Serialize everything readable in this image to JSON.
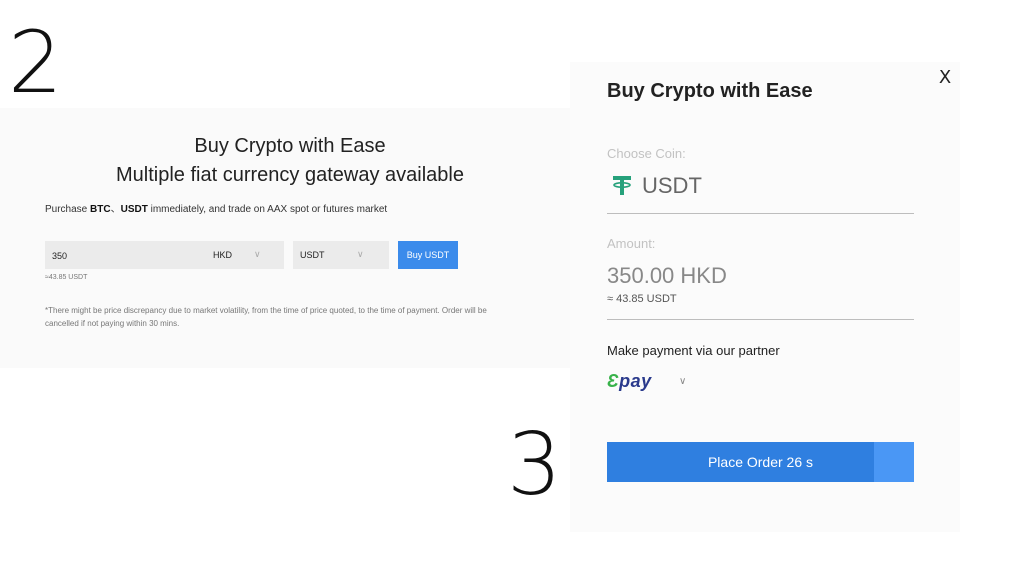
{
  "steps": {
    "left": "2",
    "right": "3"
  },
  "left_panel": {
    "title_line1": "Buy Crypto with Ease",
    "title_line2": "Multiple fiat currency gateway available",
    "purchase_prefix": "Purchase ",
    "purchase_btc": "BTC",
    "purchase_sep": "、",
    "purchase_usdt": "USDT",
    "purchase_suffix": " immediately, and trade on AAX spot or futures market",
    "amount_value": "350",
    "fiat_currency": "HKD",
    "crypto_currency": "USDT",
    "buy_button": "Buy USDT",
    "approx": "≈43.85 USDT",
    "disclaimer": "*There might be price discrepancy due to market volatility, from the time of price quoted, to the time of payment. Order will be cancelled if not paying within 30 mins."
  },
  "modal": {
    "title": "Buy Crypto with Ease",
    "close": "X",
    "coin_label": "Choose Coin:",
    "coin_value": "USDT",
    "amount_label": "Amount:",
    "amount_value": "350.00 HKD",
    "approx": "≈ 43.85 USDT",
    "partner_label": "Make payment via our partner",
    "partner_e": "Ɛ",
    "partner_rest": "pay",
    "place_order": "Place Order 26 s",
    "countdown_progress": 0.87
  },
  "icons": {
    "chevron": "chevron-down-icon",
    "tether": "tether-icon",
    "close": "close-icon"
  },
  "colors": {
    "accent": "#2f7fe0",
    "tether": "#26a17b",
    "epay_blue": "#2a3a8c",
    "epay_green": "#38b24a"
  }
}
